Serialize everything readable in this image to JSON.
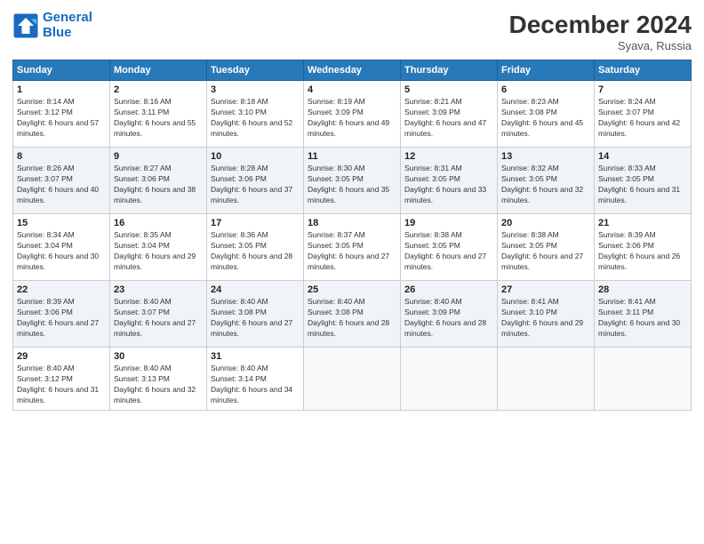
{
  "logo": {
    "line1": "General",
    "line2": "Blue"
  },
  "title": "December 2024",
  "location": "Syava, Russia",
  "weekdays": [
    "Sunday",
    "Monday",
    "Tuesday",
    "Wednesday",
    "Thursday",
    "Friday",
    "Saturday"
  ],
  "weeks": [
    [
      {
        "day": "1",
        "sunrise": "8:14 AM",
        "sunset": "3:12 PM",
        "daylight": "6 hours and 57 minutes."
      },
      {
        "day": "2",
        "sunrise": "8:16 AM",
        "sunset": "3:11 PM",
        "daylight": "6 hours and 55 minutes."
      },
      {
        "day": "3",
        "sunrise": "8:18 AM",
        "sunset": "3:10 PM",
        "daylight": "6 hours and 52 minutes."
      },
      {
        "day": "4",
        "sunrise": "8:19 AM",
        "sunset": "3:09 PM",
        "daylight": "6 hours and 49 minutes."
      },
      {
        "day": "5",
        "sunrise": "8:21 AM",
        "sunset": "3:09 PM",
        "daylight": "6 hours and 47 minutes."
      },
      {
        "day": "6",
        "sunrise": "8:23 AM",
        "sunset": "3:08 PM",
        "daylight": "6 hours and 45 minutes."
      },
      {
        "day": "7",
        "sunrise": "8:24 AM",
        "sunset": "3:07 PM",
        "daylight": "6 hours and 42 minutes."
      }
    ],
    [
      {
        "day": "8",
        "sunrise": "8:26 AM",
        "sunset": "3:07 PM",
        "daylight": "6 hours and 40 minutes."
      },
      {
        "day": "9",
        "sunrise": "8:27 AM",
        "sunset": "3:06 PM",
        "daylight": "6 hours and 38 minutes."
      },
      {
        "day": "10",
        "sunrise": "8:28 AM",
        "sunset": "3:06 PM",
        "daylight": "6 hours and 37 minutes."
      },
      {
        "day": "11",
        "sunrise": "8:30 AM",
        "sunset": "3:05 PM",
        "daylight": "6 hours and 35 minutes."
      },
      {
        "day": "12",
        "sunrise": "8:31 AM",
        "sunset": "3:05 PM",
        "daylight": "6 hours and 33 minutes."
      },
      {
        "day": "13",
        "sunrise": "8:32 AM",
        "sunset": "3:05 PM",
        "daylight": "6 hours and 32 minutes."
      },
      {
        "day": "14",
        "sunrise": "8:33 AM",
        "sunset": "3:05 PM",
        "daylight": "6 hours and 31 minutes."
      }
    ],
    [
      {
        "day": "15",
        "sunrise": "8:34 AM",
        "sunset": "3:04 PM",
        "daylight": "6 hours and 30 minutes."
      },
      {
        "day": "16",
        "sunrise": "8:35 AM",
        "sunset": "3:04 PM",
        "daylight": "6 hours and 29 minutes."
      },
      {
        "day": "17",
        "sunrise": "8:36 AM",
        "sunset": "3:05 PM",
        "daylight": "6 hours and 28 minutes."
      },
      {
        "day": "18",
        "sunrise": "8:37 AM",
        "sunset": "3:05 PM",
        "daylight": "6 hours and 27 minutes."
      },
      {
        "day": "19",
        "sunrise": "8:38 AM",
        "sunset": "3:05 PM",
        "daylight": "6 hours and 27 minutes."
      },
      {
        "day": "20",
        "sunrise": "8:38 AM",
        "sunset": "3:05 PM",
        "daylight": "6 hours and 27 minutes."
      },
      {
        "day": "21",
        "sunrise": "8:39 AM",
        "sunset": "3:06 PM",
        "daylight": "6 hours and 26 minutes."
      }
    ],
    [
      {
        "day": "22",
        "sunrise": "8:39 AM",
        "sunset": "3:06 PM",
        "daylight": "6 hours and 27 minutes."
      },
      {
        "day": "23",
        "sunrise": "8:40 AM",
        "sunset": "3:07 PM",
        "daylight": "6 hours and 27 minutes."
      },
      {
        "day": "24",
        "sunrise": "8:40 AM",
        "sunset": "3:08 PM",
        "daylight": "6 hours and 27 minutes."
      },
      {
        "day": "25",
        "sunrise": "8:40 AM",
        "sunset": "3:08 PM",
        "daylight": "6 hours and 28 minutes."
      },
      {
        "day": "26",
        "sunrise": "8:40 AM",
        "sunset": "3:09 PM",
        "daylight": "6 hours and 28 minutes."
      },
      {
        "day": "27",
        "sunrise": "8:41 AM",
        "sunset": "3:10 PM",
        "daylight": "6 hours and 29 minutes."
      },
      {
        "day": "28",
        "sunrise": "8:41 AM",
        "sunset": "3:11 PM",
        "daylight": "6 hours and 30 minutes."
      }
    ],
    [
      {
        "day": "29",
        "sunrise": "8:40 AM",
        "sunset": "3:12 PM",
        "daylight": "6 hours and 31 minutes."
      },
      {
        "day": "30",
        "sunrise": "8:40 AM",
        "sunset": "3:13 PM",
        "daylight": "6 hours and 32 minutes."
      },
      {
        "day": "31",
        "sunrise": "8:40 AM",
        "sunset": "3:14 PM",
        "daylight": "6 hours and 34 minutes."
      },
      null,
      null,
      null,
      null
    ]
  ]
}
